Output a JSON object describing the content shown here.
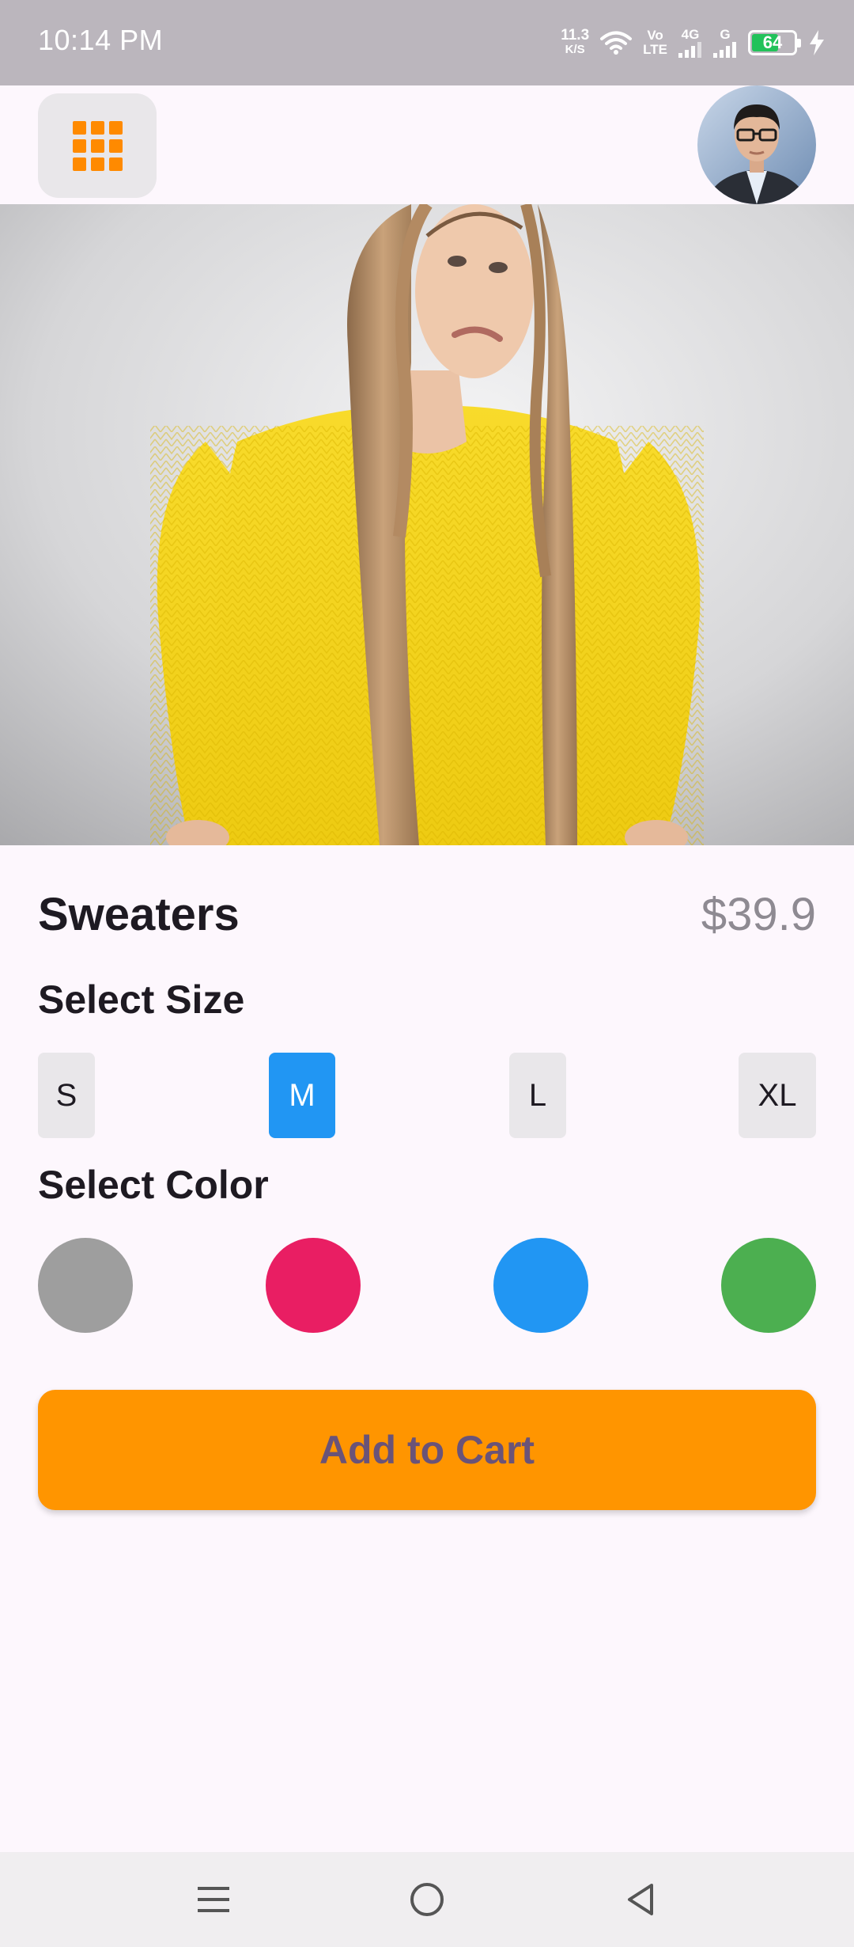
{
  "status_bar": {
    "time": "10:14 PM",
    "net_speed_value": "11.3",
    "net_speed_unit": "K/S",
    "volte_top": "Vo",
    "volte_bottom": "LTE",
    "network_type": "4G",
    "network_type_2": "G",
    "battery_level": "64",
    "battery_fraction": 0.64,
    "icons": [
      "wifi-icon",
      "signal-icon",
      "battery-icon",
      "charging-icon"
    ]
  },
  "header": {
    "menu_icon": "grid-icon",
    "avatar": "avatar"
  },
  "product": {
    "title": "Sweaters",
    "price": "$39.9"
  },
  "size": {
    "heading": "Select Size",
    "options": [
      "S",
      "M",
      "L",
      "XL"
    ],
    "selected": "M"
  },
  "color": {
    "heading": "Select Color",
    "swatches": [
      "#9E9E9E",
      "#E91E63",
      "#2196F3",
      "#4CAF50"
    ]
  },
  "cart": {
    "label": "Add to Cart"
  },
  "nav": {
    "icons": [
      "menu-icon",
      "home-icon",
      "back-icon"
    ]
  },
  "colors": {
    "accent": "#FF9500",
    "grid_icon": "#FF8A00",
    "selected_chip": "#2196F3",
    "cart_text": "#6A5378",
    "battery": "#22C25A"
  }
}
